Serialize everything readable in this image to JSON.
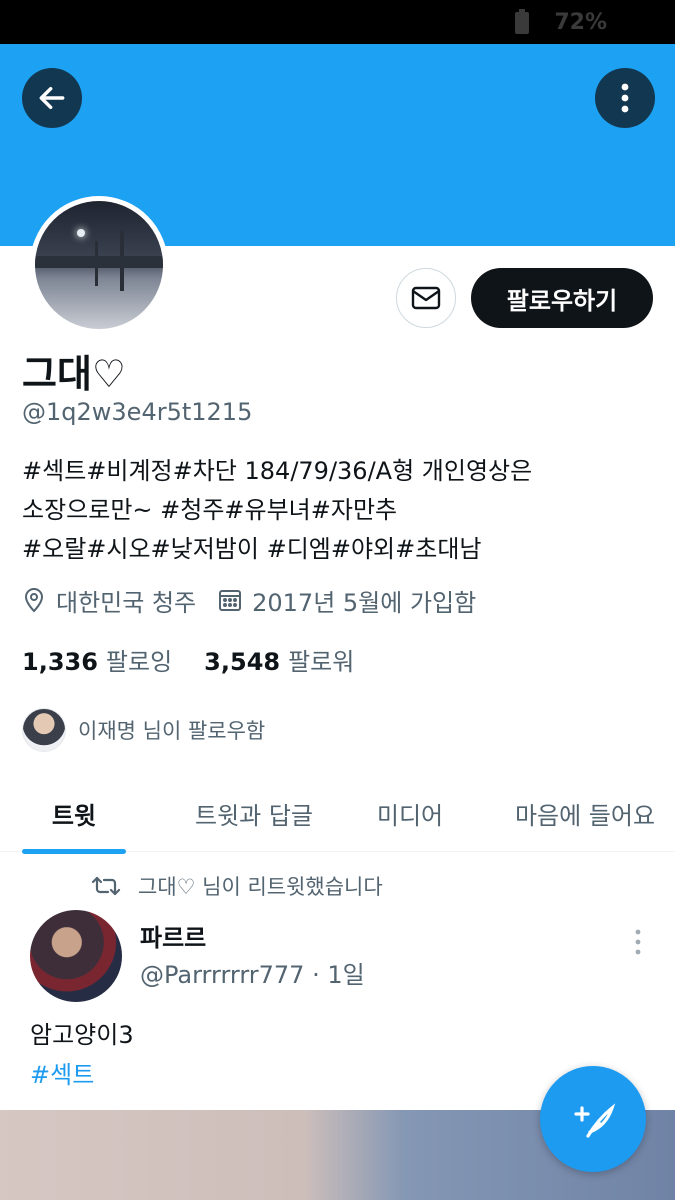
{
  "status_bar": {
    "battery_text": "72%"
  },
  "header": {
    "back_icon": "arrow-left-icon",
    "more_icon": "more-vertical-icon"
  },
  "profile": {
    "display_name": "그대♡",
    "handle": "@1q2w3e4r5t1215",
    "bio_lines": [
      "#섹트#비계정#차단 184/79/36/A형 개인영상은",
      "소장으로만~ #청주#유부녀#자만추",
      "#오랄#시오#낮저밤이 #디엠#야외#초대남"
    ],
    "location": "대한민국 청주",
    "joined": "2017년 5월에 가입함",
    "following_count": "1,336",
    "following_label": "팔로잉",
    "followers_count": "3,548",
    "followers_label": "팔로워",
    "followed_by": "이재명 님이 팔로우함",
    "follow_button": "팔로우하기"
  },
  "tabs": [
    {
      "label": "트윗",
      "active": true
    },
    {
      "label": "트윗과 답글",
      "active": false
    },
    {
      "label": "미디어",
      "active": false
    },
    {
      "label": "마음에 들어요",
      "active": false
    }
  ],
  "tweet": {
    "retweet_notice": "그대♡ 님이 리트윗했습니다",
    "author_name": "파르르",
    "author_handle": "@Parrrrrrr777 · 1일",
    "text": "암고양이3",
    "hashtag": "#섹트"
  },
  "colors": {
    "accent": "#1da1f2",
    "dark": "#0f1419",
    "muted": "#536471"
  }
}
